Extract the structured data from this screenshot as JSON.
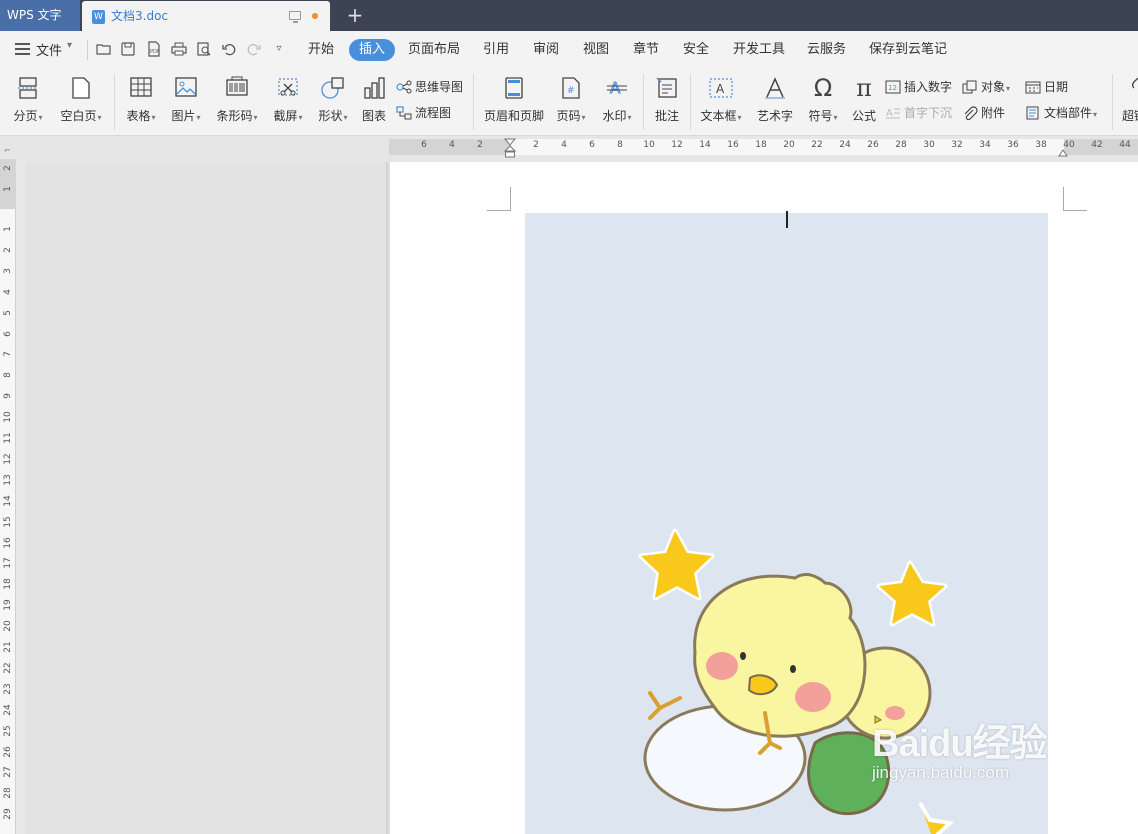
{
  "titlebar": {
    "app_name": "WPS 文字",
    "doc_tab": "文档3.doc",
    "new_tab": "+"
  },
  "menubar": {
    "file_label": "文件",
    "tabs": [
      "开始",
      "插入",
      "页面布局",
      "引用",
      "审阅",
      "视图",
      "章节",
      "安全",
      "开发工具",
      "云服务",
      "保存到云笔记"
    ],
    "active_tab": "插入"
  },
  "ribbon": {
    "page_break": "分页",
    "blank_page": "空白页",
    "table": "表格",
    "picture": "图片",
    "barcode": "条形码",
    "screenshot": "截屏",
    "shape": "形状",
    "chart": "图表",
    "mindmap": "思维导图",
    "flowchart": "流程图",
    "header_footer": "页眉和页脚",
    "page_number": "页码",
    "watermark": "水印",
    "comment": "批注",
    "textbox": "文本框",
    "wordart": "艺术字",
    "symbol": "符号",
    "formula": "公式",
    "insert_number": "插入数字",
    "drop_cap": "首字下沉",
    "object": "对象",
    "attachment": "附件",
    "date": "日期",
    "doc_parts": "文档部件",
    "hyperlink": "超链"
  },
  "ruler": {
    "h_numbers": [
      "6",
      "4",
      "2",
      "2",
      "4",
      "6",
      "8",
      "10",
      "12",
      "14",
      "16",
      "18",
      "20",
      "22",
      "24",
      "26",
      "28",
      "30",
      "32",
      "34",
      "36",
      "38",
      "40",
      "42",
      "44"
    ],
    "v_numbers": [
      "2",
      "1",
      "1",
      "2",
      "3",
      "4",
      "5",
      "6",
      "7",
      "8",
      "9",
      "10",
      "11",
      "12",
      "13",
      "14",
      "15",
      "16",
      "17",
      "18",
      "19",
      "20",
      "21",
      "22",
      "23",
      "24",
      "25",
      "26",
      "27",
      "28",
      "29"
    ]
  },
  "watermark": {
    "brand": "Baidu经验",
    "url": "jingyan.baidu.com"
  },
  "colors": {
    "titlebar_bg": "#3c4353",
    "app_tab_bg": "#4a6fa8",
    "active_tab_bg": "#4a8fdc",
    "page_bg_fill": "#dde5f0",
    "star": "#f8c81a",
    "chick": "#faf5a0",
    "cheek": "#f4a09a"
  }
}
